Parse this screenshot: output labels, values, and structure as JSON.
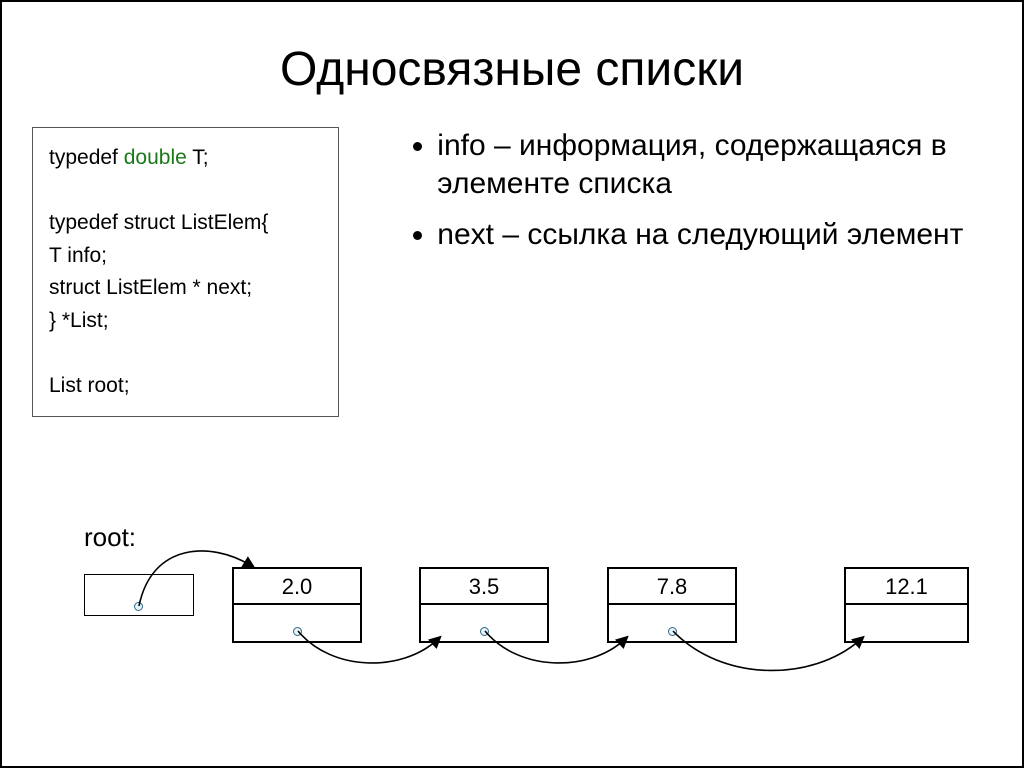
{
  "title": "Односвязные списки",
  "code": {
    "line1_pre": "typedef ",
    "line1_kw": "double",
    "line1_post": " T;",
    "line2": "typedef struct ListElem{",
    "line3": "   T info;",
    "line4": "   struct ListElem * next;",
    "line5": "} *List;",
    "line6": "List root;"
  },
  "bullets": {
    "b1": "info – информация, содержащаяся в элементе списка",
    "b2": "next – ссылка на следующий элемент"
  },
  "diagram": {
    "root_label": "root:",
    "nodes": [
      "2.0",
      "3.5",
      "7.8",
      "12.1"
    ]
  }
}
